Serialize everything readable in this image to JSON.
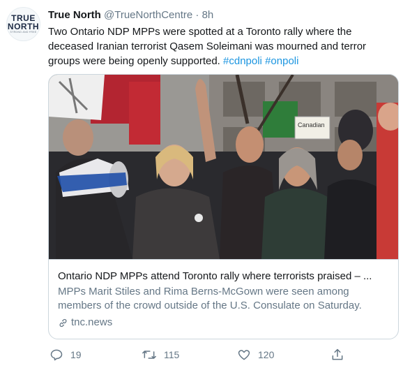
{
  "profile": {
    "avatar_line1": "TRUE",
    "avatar_line2": "NORTH",
    "avatar_line3": "STRONG AND FREE",
    "name": "True North",
    "handle": "@TrueNorthCentre",
    "separator": "·",
    "time": "8h"
  },
  "tweet": {
    "text": "Two Ontario NDP MPPs were spotted at a Toronto rally where the deceased Iranian terrorist Qasem Soleimani was mourned and terror groups were being openly supported. ",
    "hashtag1": "#cdnpoli",
    "hashtag2": "#onpoli"
  },
  "card": {
    "photo_sign_text": "Canadian",
    "title": "Ontario NDP MPPs attend Toronto rally where terrorists praised – ...",
    "description": "MPPs Marit Stiles and Rima Berns-McGown were seen among members of the crowd outside of the U.S. Consulate on Saturday.",
    "domain": "tnc.news"
  },
  "actions": {
    "reply_count": "19",
    "retweet_count": "115",
    "like_count": "120"
  },
  "colors": {
    "link": "#1b95e0",
    "secondary_text": "#657786",
    "border": "#ccd6dd"
  }
}
